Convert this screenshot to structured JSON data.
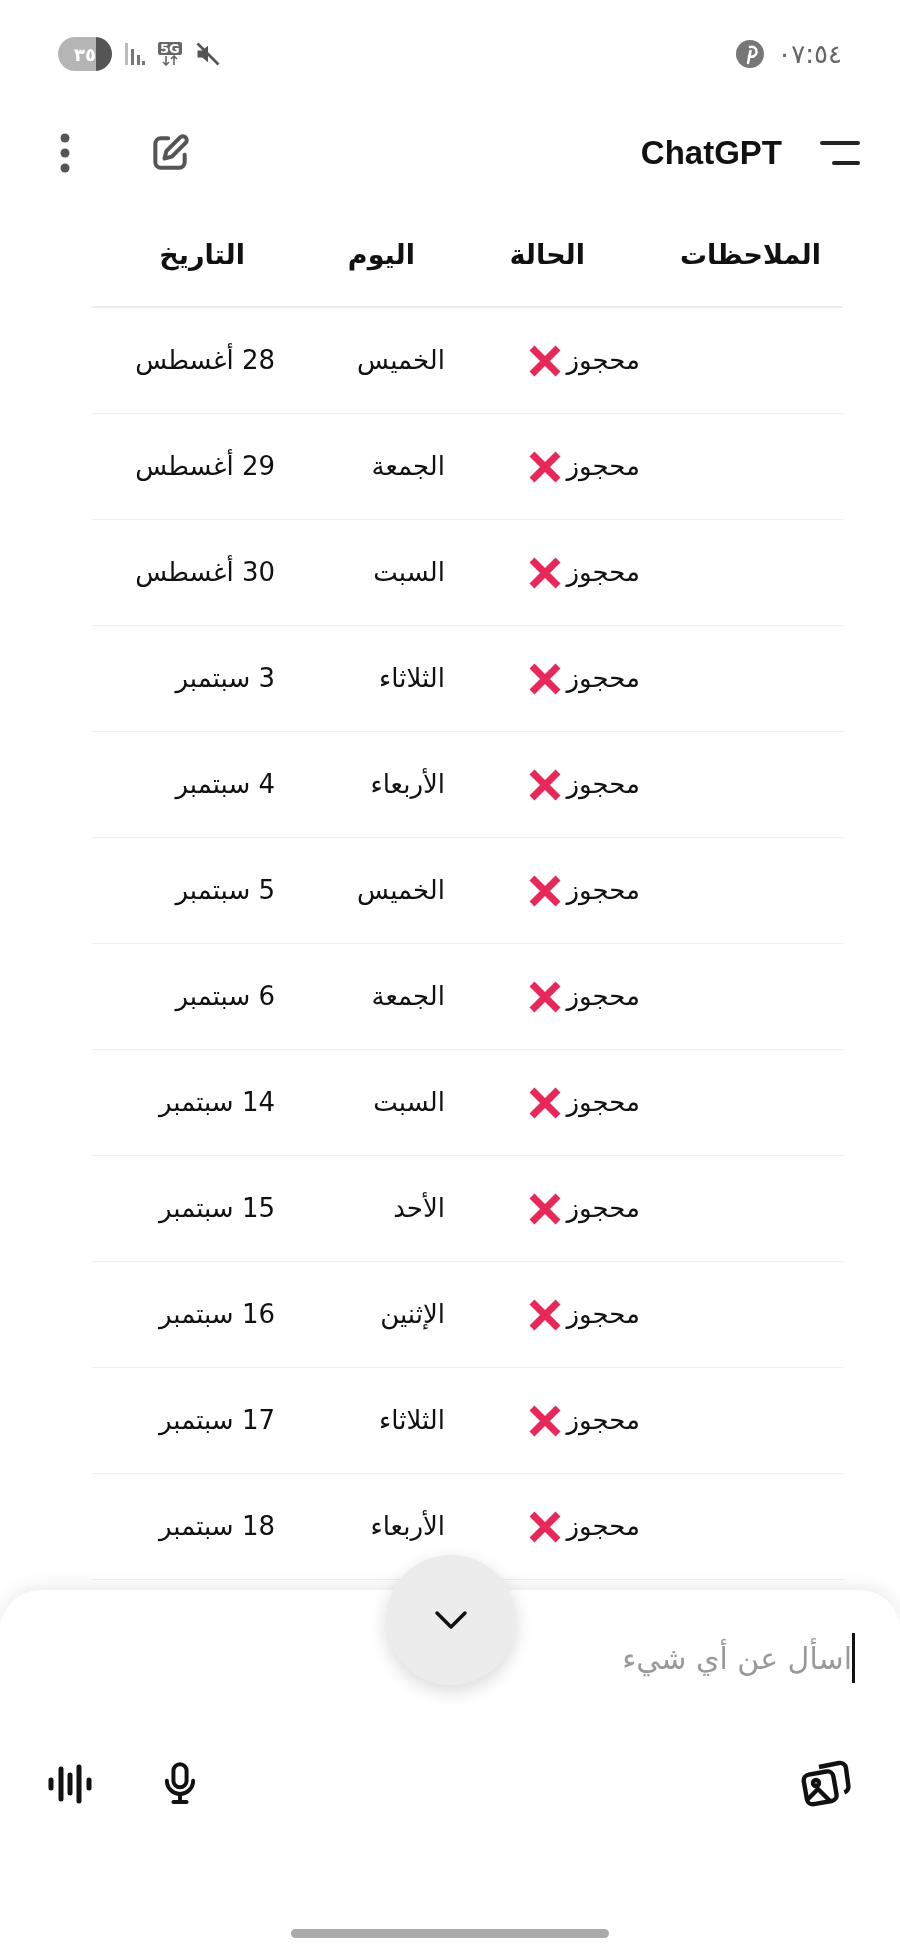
{
  "status_bar": {
    "time": "٠٧:٥٤",
    "battery": "٣٥",
    "network": "5G"
  },
  "header": {
    "title": "ChatGPT"
  },
  "table": {
    "columns": [
      "الملاحظات",
      "الحالة",
      "اليوم",
      "التاريخ"
    ],
    "rows": [
      {
        "status": "محجوز",
        "day": "الخميس",
        "date": "28 أغسطس"
      },
      {
        "status": "محجوز",
        "day": "الجمعة",
        "date": "29 أغسطس"
      },
      {
        "status": "محجوز",
        "day": "السبت",
        "date": "30 أغسطس"
      },
      {
        "status": "محجوز",
        "day": "الثلاثاء",
        "date": "3 سبتمبر"
      },
      {
        "status": "محجوز",
        "day": "الأربعاء",
        "date": "4 سبتمبر"
      },
      {
        "status": "محجوز",
        "day": "الخميس",
        "date": "5 سبتمبر"
      },
      {
        "status": "محجوز",
        "day": "الجمعة",
        "date": "6 سبتمبر"
      },
      {
        "status": "محجوز",
        "day": "السبت",
        "date": "14 سبتمبر"
      },
      {
        "status": "محجوز",
        "day": "الأحد",
        "date": "15 سبتمبر"
      },
      {
        "status": "محجوز",
        "day": "الإثنين",
        "date": "16 سبتمبر"
      },
      {
        "status": "محجوز",
        "day": "الثلاثاء",
        "date": "17 سبتمبر"
      },
      {
        "status": "محجوز",
        "day": "الأربعاء",
        "date": "18 سبتمبر"
      }
    ]
  },
  "composer": {
    "placeholder": "اسأل عن أي شيء"
  }
}
